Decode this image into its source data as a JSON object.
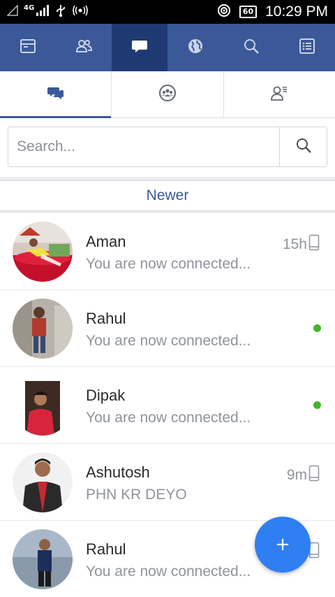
{
  "status_bar": {
    "network": "4G",
    "battery": "60",
    "time": "10:29 PM"
  },
  "nav": {
    "items": [
      {
        "icon": "newsfeed-icon"
      },
      {
        "icon": "friends-icon"
      },
      {
        "icon": "messages-icon",
        "active": true
      },
      {
        "icon": "globe-icon"
      },
      {
        "icon": "search-icon"
      },
      {
        "icon": "menu-list-icon"
      }
    ]
  },
  "subtabs": [
    {
      "icon": "chats-icon",
      "active": true
    },
    {
      "icon": "groups-icon"
    },
    {
      "icon": "contacts-icon"
    }
  ],
  "search": {
    "placeholder": "Search...",
    "value": ""
  },
  "newer_label": "Newer",
  "conversations": [
    {
      "name": "Aman",
      "preview": "You are now connected...",
      "time": "15h",
      "device": "phone-icon",
      "online": false
    },
    {
      "name": "Rahul",
      "preview": "You are now connected...",
      "time": "",
      "online": true
    },
    {
      "name": "Dipak",
      "preview": "You are now connected...",
      "time": "",
      "online": true
    },
    {
      "name": "Ashutosh",
      "preview": "PHN KR DEYO",
      "time": "9m",
      "device": "phone-icon",
      "online": false
    },
    {
      "name": "Rahul",
      "preview": "You are now connected...",
      "time": "",
      "device": "phone-icon",
      "online": false
    }
  ],
  "fab": {
    "label": "+"
  },
  "colors": {
    "brand": "#3b5998",
    "brand_active": "#1f3a73",
    "online": "#42b72a",
    "fab": "#2f7ff2"
  }
}
